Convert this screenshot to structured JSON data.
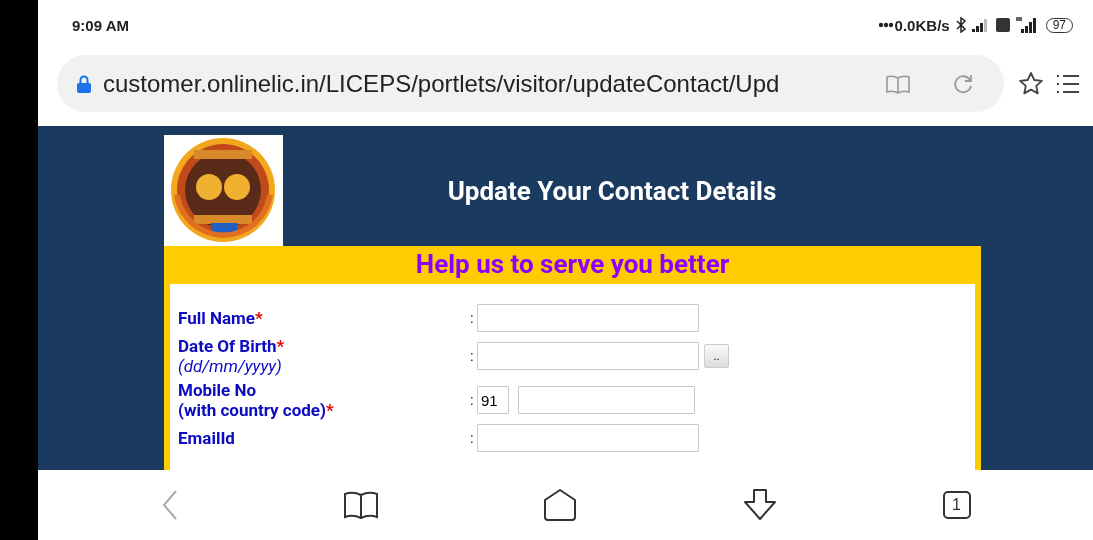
{
  "status_bar": {
    "time": "9:09 AM",
    "network_speed": "0.0KB/s",
    "battery": "97"
  },
  "address_bar": {
    "url": "customer.onlinelic.in/LICEPS/portlets/visitor/updateContact/Upd"
  },
  "page": {
    "title": "Update Your Contact Details",
    "form": {
      "heading": "Help us to serve you better",
      "fields": [
        {
          "kind": "text",
          "label": "Full Name",
          "required_mark": "*",
          "separator": ":"
        },
        {
          "kind": "date",
          "label": "Date Of Birth",
          "required_mark": "*",
          "hint": "(dd/mm/yyyy)",
          "separator": ":",
          "button": ".."
        },
        {
          "kind": "phone",
          "label": "Mobile No",
          "label_2": "(with country code)",
          "required_mark": "*",
          "separator": ":",
          "value": "91"
        },
        {
          "kind": "text",
          "label": "EmailId",
          "separator": ":"
        }
      ]
    }
  },
  "bottom_nav": {
    "tab_count": "1"
  }
}
